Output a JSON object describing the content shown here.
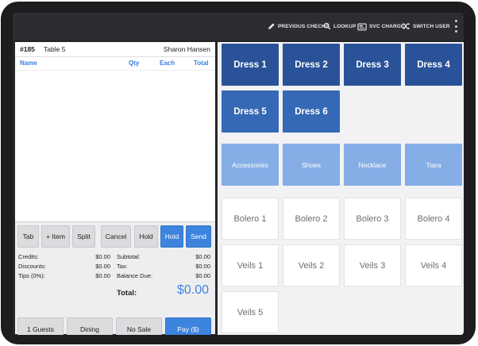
{
  "topbar": {
    "actions": [
      {
        "label": "PREVIOUS CHECKS",
        "icon": "pencil-icon"
      },
      {
        "label": "LOOKUP",
        "icon": "search-icon"
      },
      {
        "label": "SVC CHARGE",
        "icon": "service-charge-icon"
      },
      {
        "label": "SWITCH USER",
        "icon": "shuffle-icon"
      }
    ],
    "menu_icon": "more-vertical-icon"
  },
  "order": {
    "number": "#185",
    "table": "Table 5",
    "server": "Sharon Hansen",
    "columns": {
      "name": "Name",
      "qty": "Qty",
      "each": "Each",
      "total": "Total"
    }
  },
  "actions": [
    {
      "label": "Tab",
      "style": "gray"
    },
    {
      "label": "+ Item",
      "style": "gray"
    },
    {
      "label": "Split",
      "style": "gray"
    },
    {
      "label": "Cancel",
      "style": "gray"
    },
    {
      "label": "Hold",
      "style": "gray"
    },
    {
      "label": "Hold",
      "style": "blue"
    },
    {
      "label": "Send",
      "style": "blue"
    }
  ],
  "totals": {
    "credits_label": "Credits:",
    "credits": "$0.00",
    "discounts_label": "Discounts:",
    "discounts": "$0.00",
    "tips_label": "Tips (0%):",
    "tips": "$0.00",
    "subtotal_label": "Subtotal:",
    "subtotal": "$0.00",
    "tax_label": "Tax:",
    "tax": "$0.00",
    "balance_label": "Balance Due:",
    "balance": "$0.00",
    "grand_label": "Total:",
    "grand": "$0.00"
  },
  "bottom": [
    {
      "label": "1 Guests",
      "style": "gray"
    },
    {
      "label": "Dining",
      "style": "gray"
    },
    {
      "label": "No Sale",
      "style": "gray"
    },
    {
      "label": "Pay ($)",
      "style": "blue"
    }
  ],
  "menu_tiles": {
    "dresses": [
      "Dress 1",
      "Dress 2",
      "Dress 3",
      "Dress 4",
      "Dress 5",
      "Dress 6"
    ],
    "categories": [
      "Accessories",
      "Shoes",
      "Necklace",
      "Tiara"
    ],
    "items": [
      "Bolero 1",
      "Bolero 2",
      "Bolero 3",
      "Bolero 4",
      "Veils 1",
      "Veils 2",
      "Veils 3",
      "Veils 4",
      "Veils 5"
    ]
  },
  "colors": {
    "dress_top": "#2a5298",
    "dress_bottom": "#3669b5",
    "category": "#85aee6",
    "accent": "#3d84de"
  }
}
